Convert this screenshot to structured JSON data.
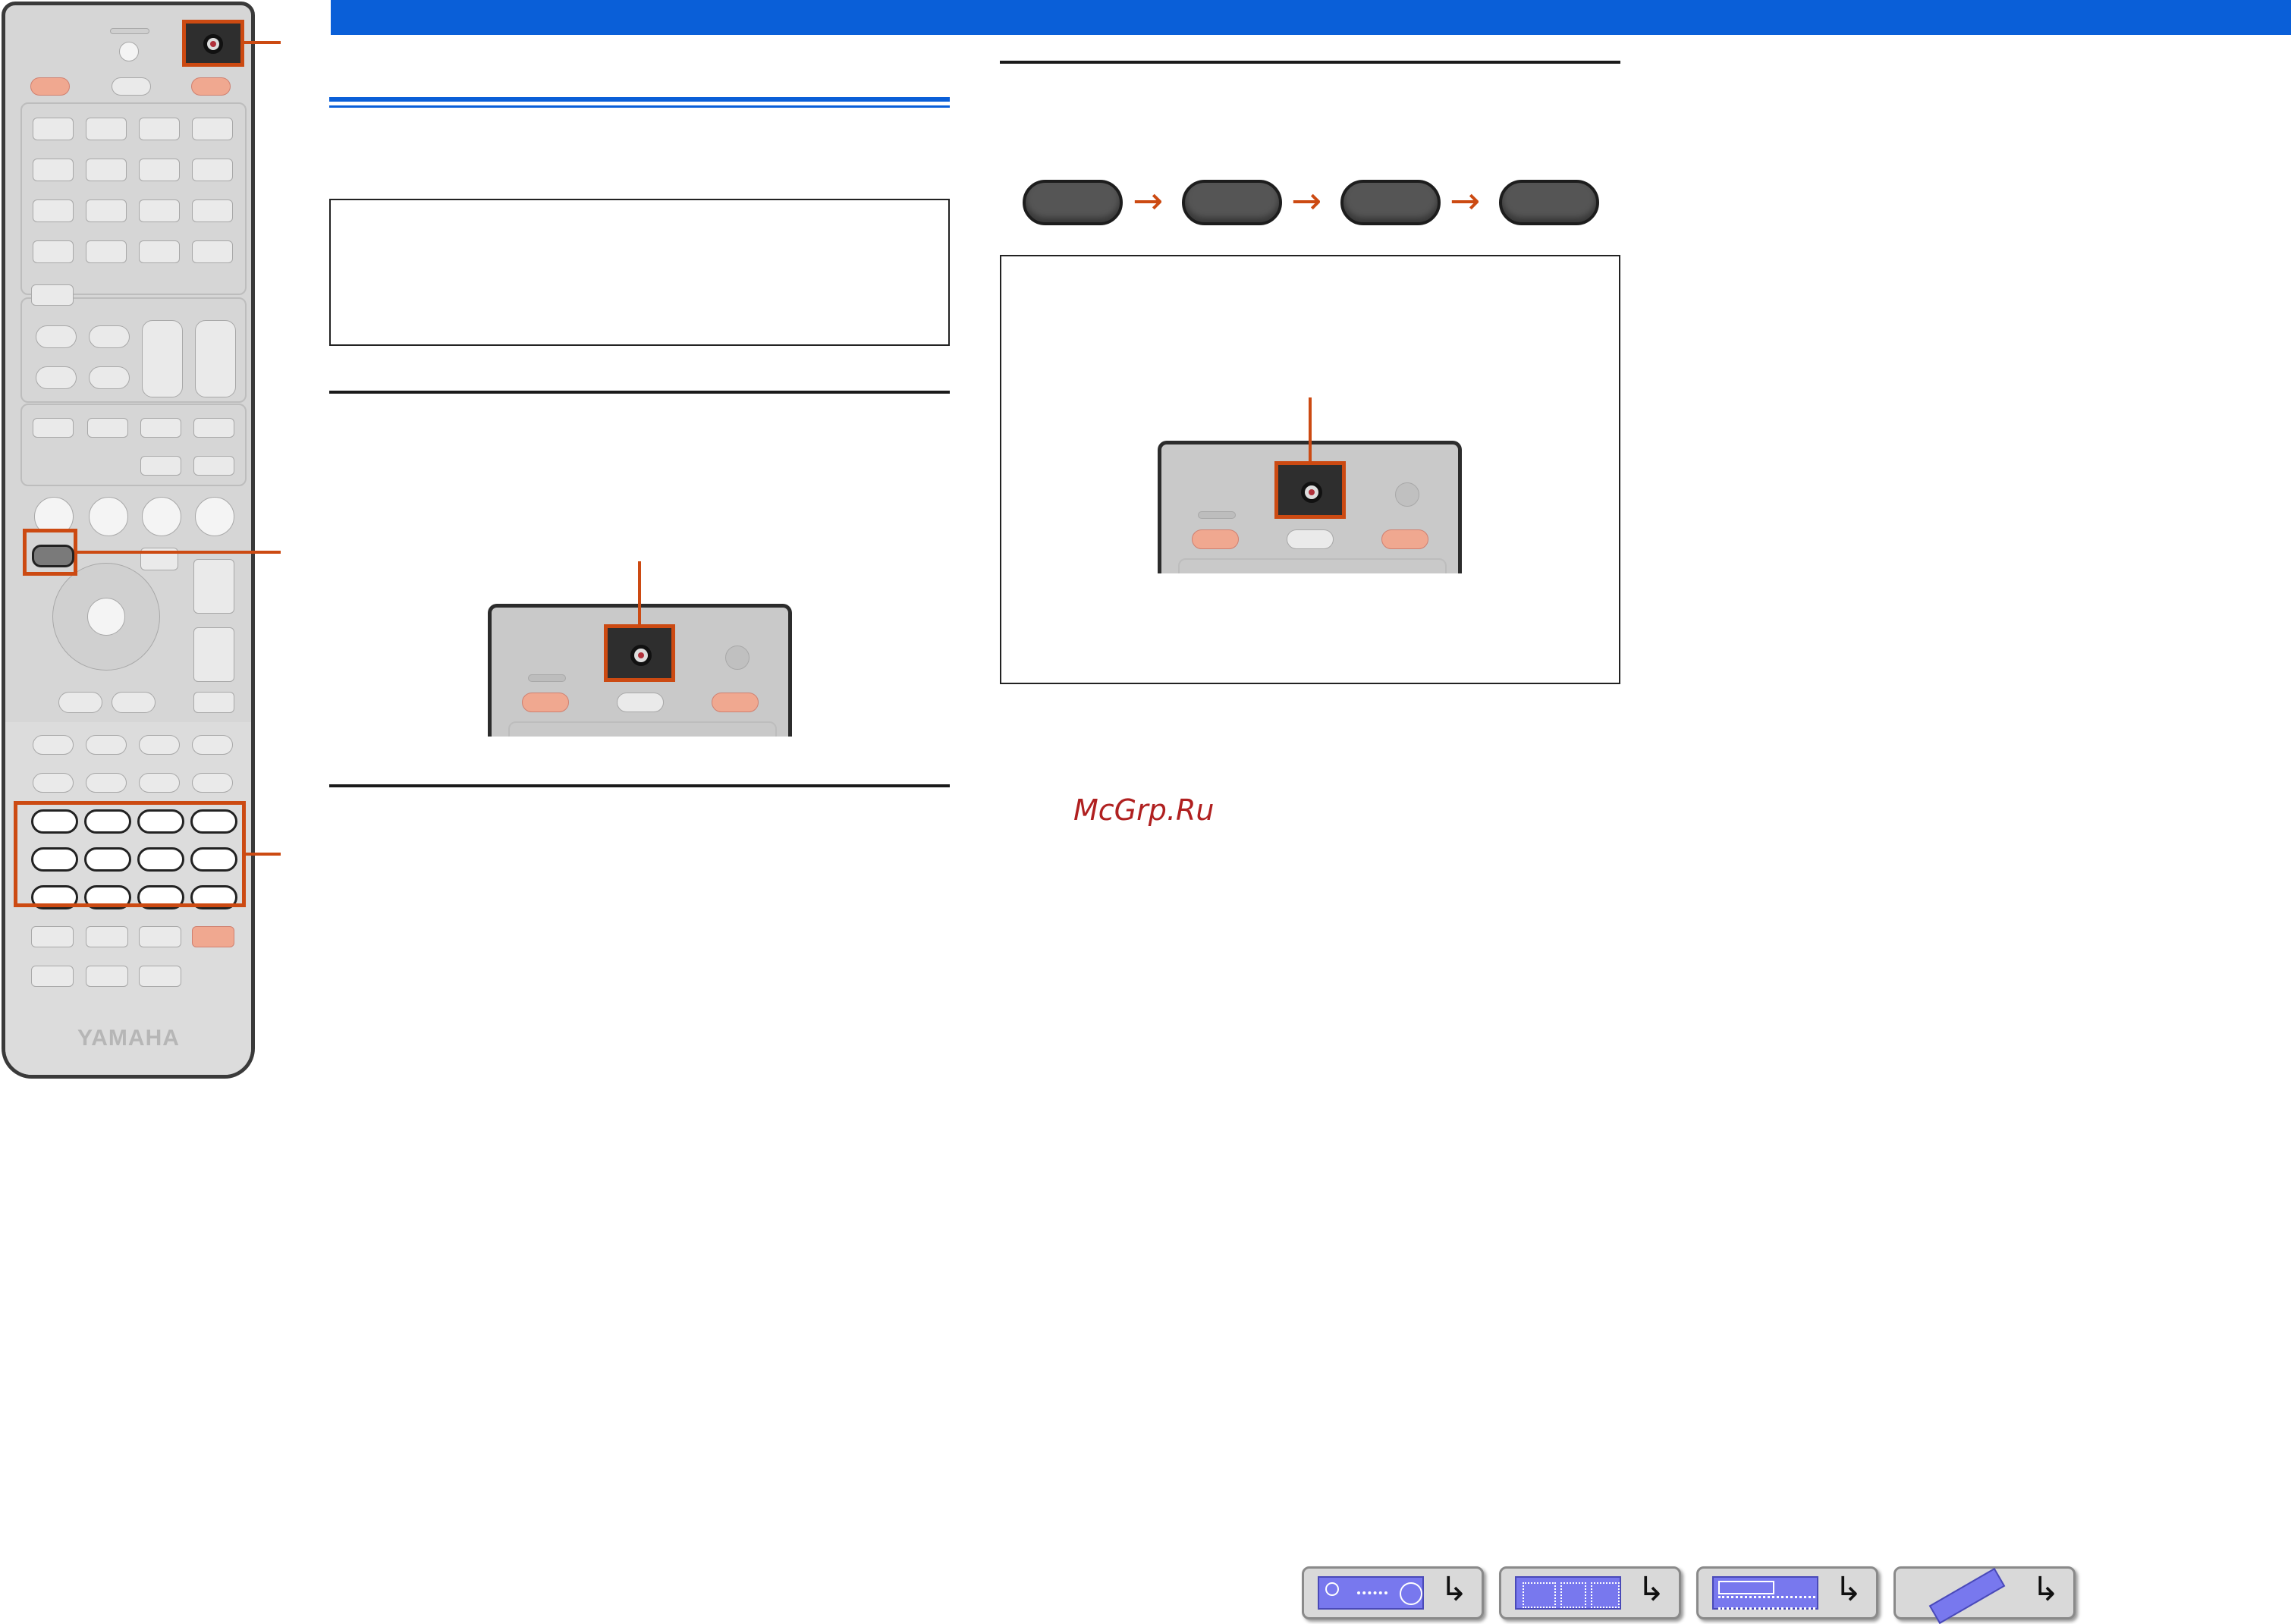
{
  "remote": {
    "brand": "YAMAHA",
    "numpad_plus": "+"
  },
  "header_bar": {
    "color": "#0a5fd8"
  },
  "step_flow": {
    "arrows": [
      "→",
      "→",
      "→"
    ]
  },
  "watermark": "McGrp.Ru",
  "nav": {
    "buttons": [
      {
        "icon": "receiver-front-panel-icon"
      },
      {
        "icon": "receiver-rear-panel-icon"
      },
      {
        "icon": "front-display-icon"
      },
      {
        "icon": "remote-control-icon"
      }
    ],
    "arrow_glyph": "↳"
  },
  "colors": {
    "accent": "#cc4a12",
    "header": "#0a5fd8"
  }
}
